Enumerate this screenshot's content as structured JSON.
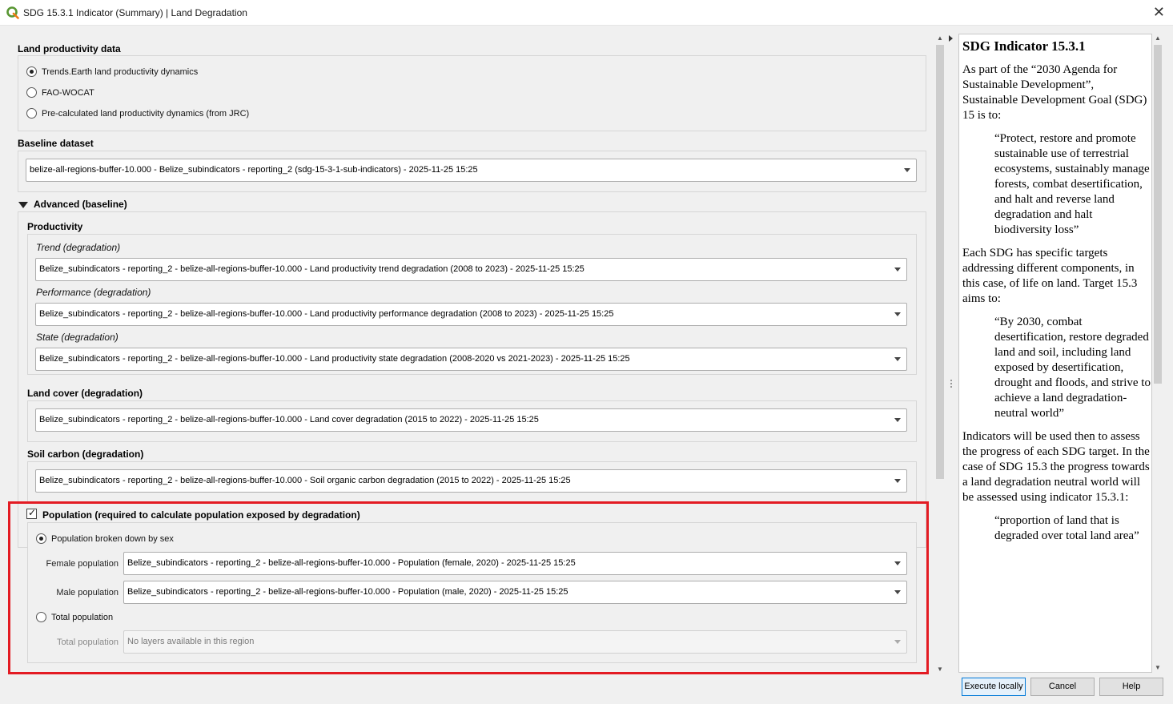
{
  "window": {
    "title": "SDG 15.3.1 Indicator (Summary) | Land Degradation",
    "close_glyph": "✕"
  },
  "land_productivity": {
    "heading": "Land productivity data",
    "options": [
      {
        "label": "Trends.Earth land productivity dynamics",
        "selected": true
      },
      {
        "label": "FAO-WOCAT",
        "selected": false
      },
      {
        "label": "Pre-calculated land productivity dynamics (from JRC)",
        "selected": false
      }
    ]
  },
  "baseline": {
    "heading": "Baseline dataset",
    "value": "belize-all-regions-buffer-10.000 - Belize_subindicators - reporting_2 (sdg-15-3-1-sub-indicators) - 2025-11-25 15:25"
  },
  "advanced": {
    "heading": "Advanced (baseline)",
    "productivity": {
      "heading": "Productivity",
      "trend_label": "Trend (degradation)",
      "trend_value": "Belize_subindicators - reporting_2 - belize-all-regions-buffer-10.000 - Land productivity trend degradation (2008 to 2023) - 2025-11-25 15:25",
      "performance_label": "Performance (degradation)",
      "performance_value": "Belize_subindicators - reporting_2 - belize-all-regions-buffer-10.000 - Land productivity performance degradation (2008 to 2023) - 2025-11-25 15:25",
      "state_label": "State (degradation)",
      "state_value": "Belize_subindicators - reporting_2 - belize-all-regions-buffer-10.000 - Land productivity state degradation (2008-2020 vs 2021-2023) - 2025-11-25 15:25"
    },
    "land_cover": {
      "heading": "Land cover (degradation)",
      "value": "Belize_subindicators - reporting_2 - belize-all-regions-buffer-10.000 - Land cover degradation (2015 to 2022) - 2025-11-25 15:25"
    },
    "soil_carbon": {
      "heading": "Soil carbon (degradation)",
      "value": "Belize_subindicators - reporting_2 - belize-all-regions-buffer-10.000 - Soil organic carbon degradation (2015 to 2022) - 2025-11-25 15:25"
    }
  },
  "population": {
    "checkbox_label": "Population (required to calculate population exposed by degradation)",
    "checked": true,
    "by_sex_label": "Population broken down by sex",
    "by_sex_selected": true,
    "female_label": "Female population",
    "female_value": "Belize_subindicators - reporting_2 - belize-all-regions-buffer-10.000 - Population (female, 2020) - 2025-11-25 15:25",
    "male_label": "Male population",
    "male_value": "Belize_subindicators - reporting_2 - belize-all-regions-buffer-10.000 - Population (male, 2020) - 2025-11-25 15:25",
    "total_radio_label": "Total population",
    "total_selected": false,
    "total_label": "Total population",
    "total_value": "No layers available in this region"
  },
  "help": {
    "title": "SDG Indicator 15.3.1",
    "p1": "As part of the “2030 Agenda for Sustainable Development”, Sustainable Development Goal (SDG) 15 is to:",
    "q1": "“Protect, restore and promote sustainable use of terrestrial ecosystems, sustainably manage forests, combat desertification, and halt and reverse land degradation and halt biodiversity loss”",
    "p2": "Each SDG has specific targets addressing different components, in this case, of life on land. Target 15.3 aims to:",
    "q2": "“By 2030, combat desertification, restore degraded land and soil, including land exposed by desertification, drought and floods, and strive to achieve a land degradation-neutral world”",
    "p3": "Indicators will be used then to assess the progress of each SDG target. In the case of SDG 15.3 the progress towards a land degradation neutral world will be assessed using indicator 15.3.1:",
    "q3": "“proportion of land that is degraded over total land area”"
  },
  "buttons": {
    "execute": "Execute locally",
    "cancel": "Cancel",
    "help": "Help"
  },
  "colors": {
    "highlight": "#e31b23",
    "qgis_green": "#589632"
  }
}
